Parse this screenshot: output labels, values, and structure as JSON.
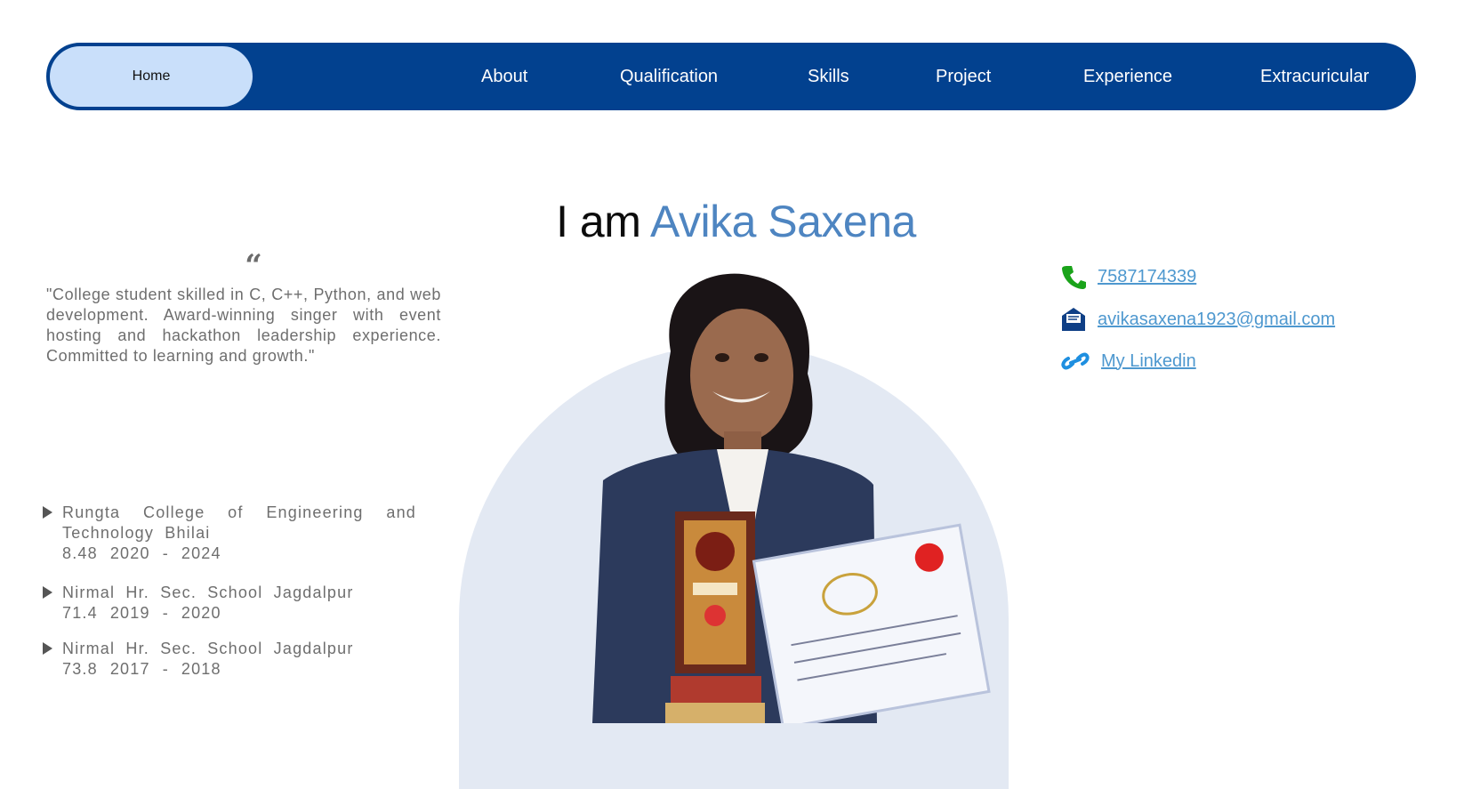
{
  "nav": {
    "home": "Home",
    "items": [
      "About",
      "Qualification",
      "Skills",
      "Project",
      "Experience",
      "Extracuricular"
    ]
  },
  "hero": {
    "prefix": "I am",
    "name": "Avika Saxena"
  },
  "quote": {
    "icon": "quote-icon",
    "text": "\"College student skilled in C, C++, Python, and web development. Award-winning singer with event hosting and hackathon leadership experience. Committed to learning and growth.\""
  },
  "education": [
    {
      "school": "Rungta College of Engineering and Technology Bhilai",
      "score": "8.48",
      "start": "2020",
      "sep": "-",
      "end": "2024"
    },
    {
      "school": "Nirmal Hr. Sec. School Jagdalpur",
      "score": "71.4",
      "start": "2019",
      "sep": "-",
      "end": "2020"
    },
    {
      "school": "Nirmal Hr. Sec. School Jagdalpur",
      "score": "73.8",
      "start": "2017",
      "sep": "-",
      "end": "2018"
    }
  ],
  "contacts": {
    "phone": "7587174339",
    "email": "avikasaxena1923@gmail.com",
    "linkedin": "My Linkedin"
  },
  "colors": {
    "nav_bg": "#02418f",
    "nav_active": "#c9dffa",
    "accent": "#4e85c1",
    "link": "#4e98cf",
    "phone_icon": "#1aa31a",
    "mail_icon": "#0f3f86",
    "link_icon": "#1e8fe0"
  }
}
